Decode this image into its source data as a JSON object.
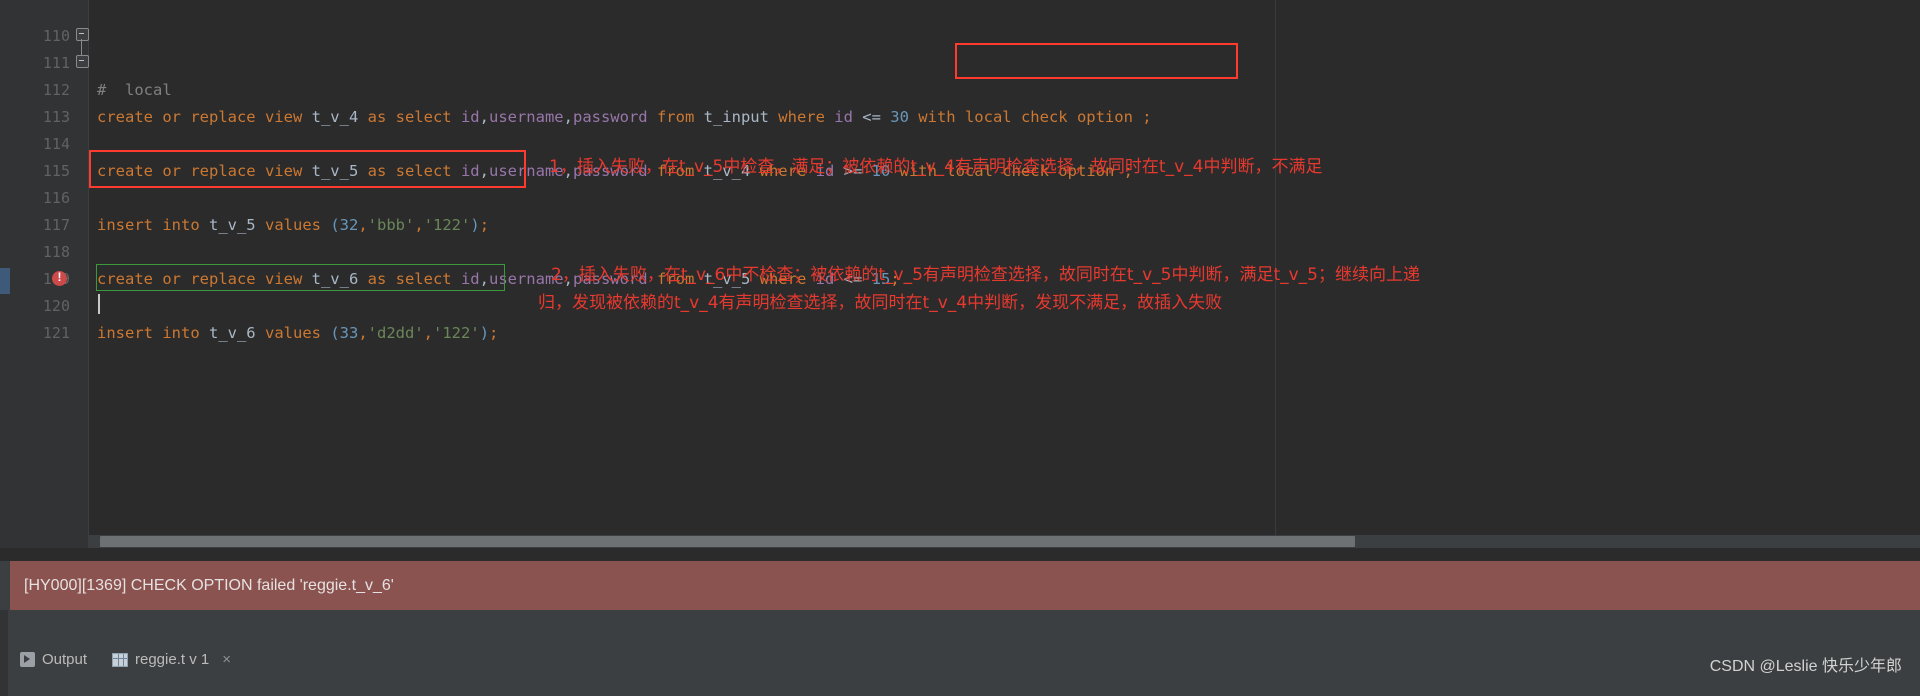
{
  "editor": {
    "lines": [
      {
        "number": "110",
        "text": ""
      },
      {
        "number": "111",
        "text": "#  local"
      },
      {
        "number": "112",
        "text": "create or replace view t_v_4 as select id,username,password from t_input where id <= 30 with local check option ;"
      },
      {
        "number": "113",
        "text": ""
      },
      {
        "number": "114",
        "text": "create or replace view t_v_5 as select id,username,password from t_v_4 where id >= 10 with local check option ;"
      },
      {
        "number": "115",
        "text": ""
      },
      {
        "number": "116",
        "text": "insert into t_v_5 values (32,'bbb','122');"
      },
      {
        "number": "117",
        "text": ""
      },
      {
        "number": "118",
        "text": "create or replace view t_v_6 as select id,username,password from t_v_5 where id <= 15;"
      },
      {
        "number": "119",
        "text": ""
      },
      {
        "number": "120",
        "text": "insert into t_v_6 values (33,'d2dd','122');"
      },
      {
        "number": "121",
        "text": ""
      }
    ],
    "tokens": {
      "line111": [
        {
          "t": "#  local",
          "c": "cmt"
        }
      ],
      "line112": [
        {
          "t": "create or replace view ",
          "c": "kw"
        },
        {
          "t": "t_v_4",
          "c": "tbl"
        },
        {
          "t": " as select ",
          "c": "kw"
        },
        {
          "t": "id",
          "c": "id"
        },
        {
          "t": ",",
          "c": "punct"
        },
        {
          "t": "username",
          "c": "id"
        },
        {
          "t": ",",
          "c": "punct"
        },
        {
          "t": "password",
          "c": "id"
        },
        {
          "t": " from ",
          "c": "kw"
        },
        {
          "t": "t_input",
          "c": "tbl"
        },
        {
          "t": " where ",
          "c": "kw"
        },
        {
          "t": "id",
          "c": "id"
        },
        {
          "t": " <= ",
          "c": "punct"
        },
        {
          "t": "30",
          "c": "num"
        },
        {
          "t": " with local check option ;",
          "c": "kw"
        }
      ],
      "line114": [
        {
          "t": "create or replace view ",
          "c": "kw"
        },
        {
          "t": "t_v_5",
          "c": "tbl"
        },
        {
          "t": " as select ",
          "c": "kw"
        },
        {
          "t": "id",
          "c": "id"
        },
        {
          "t": ",",
          "c": "punct"
        },
        {
          "t": "username",
          "c": "id"
        },
        {
          "t": ",",
          "c": "punct"
        },
        {
          "t": "password",
          "c": "id"
        },
        {
          "t": " from ",
          "c": "kw"
        },
        {
          "t": "t_v_4",
          "c": "tbl"
        },
        {
          "t": " where ",
          "c": "kw"
        },
        {
          "t": "id",
          "c": "id"
        },
        {
          "t": " >= ",
          "c": "punct"
        },
        {
          "t": "10",
          "c": "num"
        },
        {
          "t": " with local check option ;",
          "c": "kw"
        }
      ],
      "line116": [
        {
          "t": "insert into ",
          "c": "kw"
        },
        {
          "t": "t_v_5",
          "c": "tbl"
        },
        {
          "t": " values ",
          "c": "kw"
        },
        {
          "t": "(",
          "c": "num"
        },
        {
          "t": "32",
          "c": "num"
        },
        {
          "t": ",",
          "c": "kw"
        },
        {
          "t": "'bbb'",
          "c": "str"
        },
        {
          "t": ",",
          "c": "kw"
        },
        {
          "t": "'122'",
          "c": "str"
        },
        {
          "t": ")",
          "c": "num"
        },
        {
          "t": ";",
          "c": "kw"
        }
      ],
      "line118": [
        {
          "t": "create or replace view ",
          "c": "kw"
        },
        {
          "t": "t_v_6",
          "c": "tbl"
        },
        {
          "t": " as select ",
          "c": "kw"
        },
        {
          "t": "id",
          "c": "id"
        },
        {
          "t": ",",
          "c": "punct"
        },
        {
          "t": "username",
          "c": "id"
        },
        {
          "t": ",",
          "c": "punct"
        },
        {
          "t": "password",
          "c": "id"
        },
        {
          "t": " from ",
          "c": "kw"
        },
        {
          "t": "t_v_5",
          "c": "tbl"
        },
        {
          "t": " where ",
          "c": "kw"
        },
        {
          "t": "id",
          "c": "id"
        },
        {
          "t": " <= ",
          "c": "punct"
        },
        {
          "t": "15",
          "c": "num"
        },
        {
          "t": ";",
          "c": "kw"
        }
      ],
      "line120": [
        {
          "t": "insert into ",
          "c": "kw"
        },
        {
          "t": "t_v_6",
          "c": "tbl"
        },
        {
          "t": " values ",
          "c": "kw"
        },
        {
          "t": "(",
          "c": "num"
        },
        {
          "t": "33",
          "c": "num"
        },
        {
          "t": ",",
          "c": "kw"
        },
        {
          "t": "'d2dd'",
          "c": "str"
        },
        {
          "t": ",",
          "c": "kw"
        },
        {
          "t": "'122'",
          "c": "str"
        },
        {
          "t": ")",
          "c": "num"
        },
        {
          "t": ";",
          "c": "kw"
        }
      ]
    }
  },
  "annotations": {
    "note1": "1，插入失败，在t_v_5中检查，满足；被依赖的t_v_4有声明检查选择，故同时在t_v_4中判断，不满足",
    "note2_line1": "2，插入失败，在t_v_6中不检查；被依赖的t_v_5有声明检查选择，故同时在t_v_5中判断，满足t_v_5；继续向上递",
    "note2_line2": "归，发现被依赖的t_v_4有声明检查选择，故同时在t_v_4中判断，发现不满足，故插入失败",
    "color": "#e8392f"
  },
  "error_banner": {
    "message": "[HY000][1369] CHECK OPTION failed 'reggie.t_v_6'",
    "background": "#8a5350"
  },
  "bottom_bar": {
    "output_label": "Output",
    "result_tab_label": "reggie.t v 1",
    "close_label": "×"
  },
  "watermark": "CSDN @Leslie 快乐少年郎"
}
